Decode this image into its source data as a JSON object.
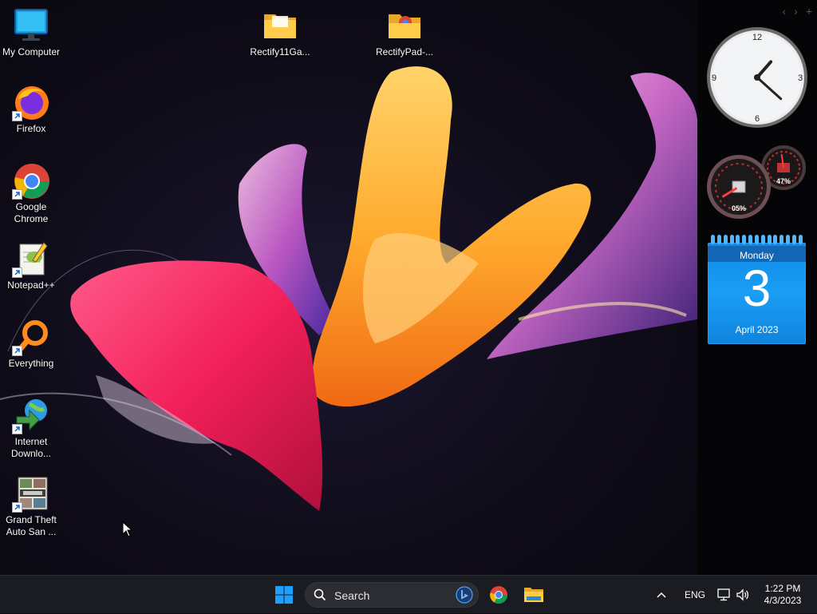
{
  "desktop": {
    "icons": [
      {
        "name": "my-computer",
        "label": "My Computer"
      },
      {
        "name": "firefox",
        "label": "Firefox"
      },
      {
        "name": "google-chrome",
        "label": "Google\nChrome"
      },
      {
        "name": "notepad-plus-plus",
        "label": "Notepad++"
      },
      {
        "name": "everything",
        "label": "Everything"
      },
      {
        "name": "internet-download-manager",
        "label": "Internet\nDownlo..."
      },
      {
        "name": "gta-san-andreas",
        "label": "Grand Theft\nAuto San ..."
      },
      {
        "name": "rectify11-folder",
        "label": "Rectify11Ga..."
      },
      {
        "name": "rectifypad-folder",
        "label": "RectifyPad-..."
      }
    ]
  },
  "gadgets": {
    "nav": {
      "prev": "‹",
      "next": "›",
      "add": "+"
    },
    "clock": {
      "numerals": [
        "12",
        "3",
        "6",
        "9"
      ],
      "hour": 1.37,
      "minute": 22
    },
    "meters": {
      "cpu_label": "05%",
      "ram_label": "47%",
      "cpu": 0.05,
      "ram": 0.47
    },
    "calendar": {
      "weekday": "Monday",
      "day": "3",
      "month_year": "April 2023"
    }
  },
  "taskbar": {
    "search": {
      "placeholder": "Search"
    },
    "tray": {
      "language": "ENG",
      "overflow": "^"
    },
    "clock": {
      "time": "1:22 PM",
      "date": "4/3/2023"
    }
  },
  "colors": {
    "taskbar_bg": "#1b1c21",
    "calendar_blue": "#1a9ef4",
    "accent_windows": "#1fa0ff"
  }
}
